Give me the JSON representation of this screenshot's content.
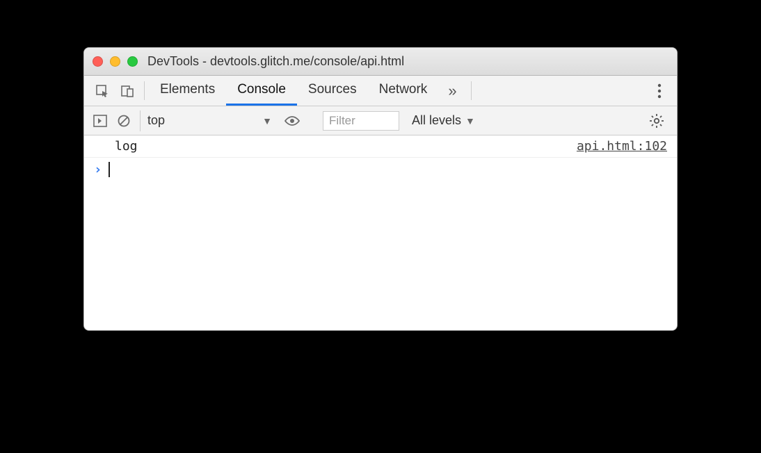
{
  "window": {
    "title": "DevTools - devtools.glitch.me/console/api.html"
  },
  "tabs": {
    "items": [
      "Elements",
      "Console",
      "Sources",
      "Network"
    ],
    "active_index": 1,
    "overflow_glyph": "»"
  },
  "toolbar": {
    "context": "top",
    "filter_placeholder": "Filter",
    "levels_label": "All levels"
  },
  "console": {
    "entries": [
      {
        "message": "log",
        "source": "api.html:102"
      }
    ],
    "prompt": "›"
  }
}
